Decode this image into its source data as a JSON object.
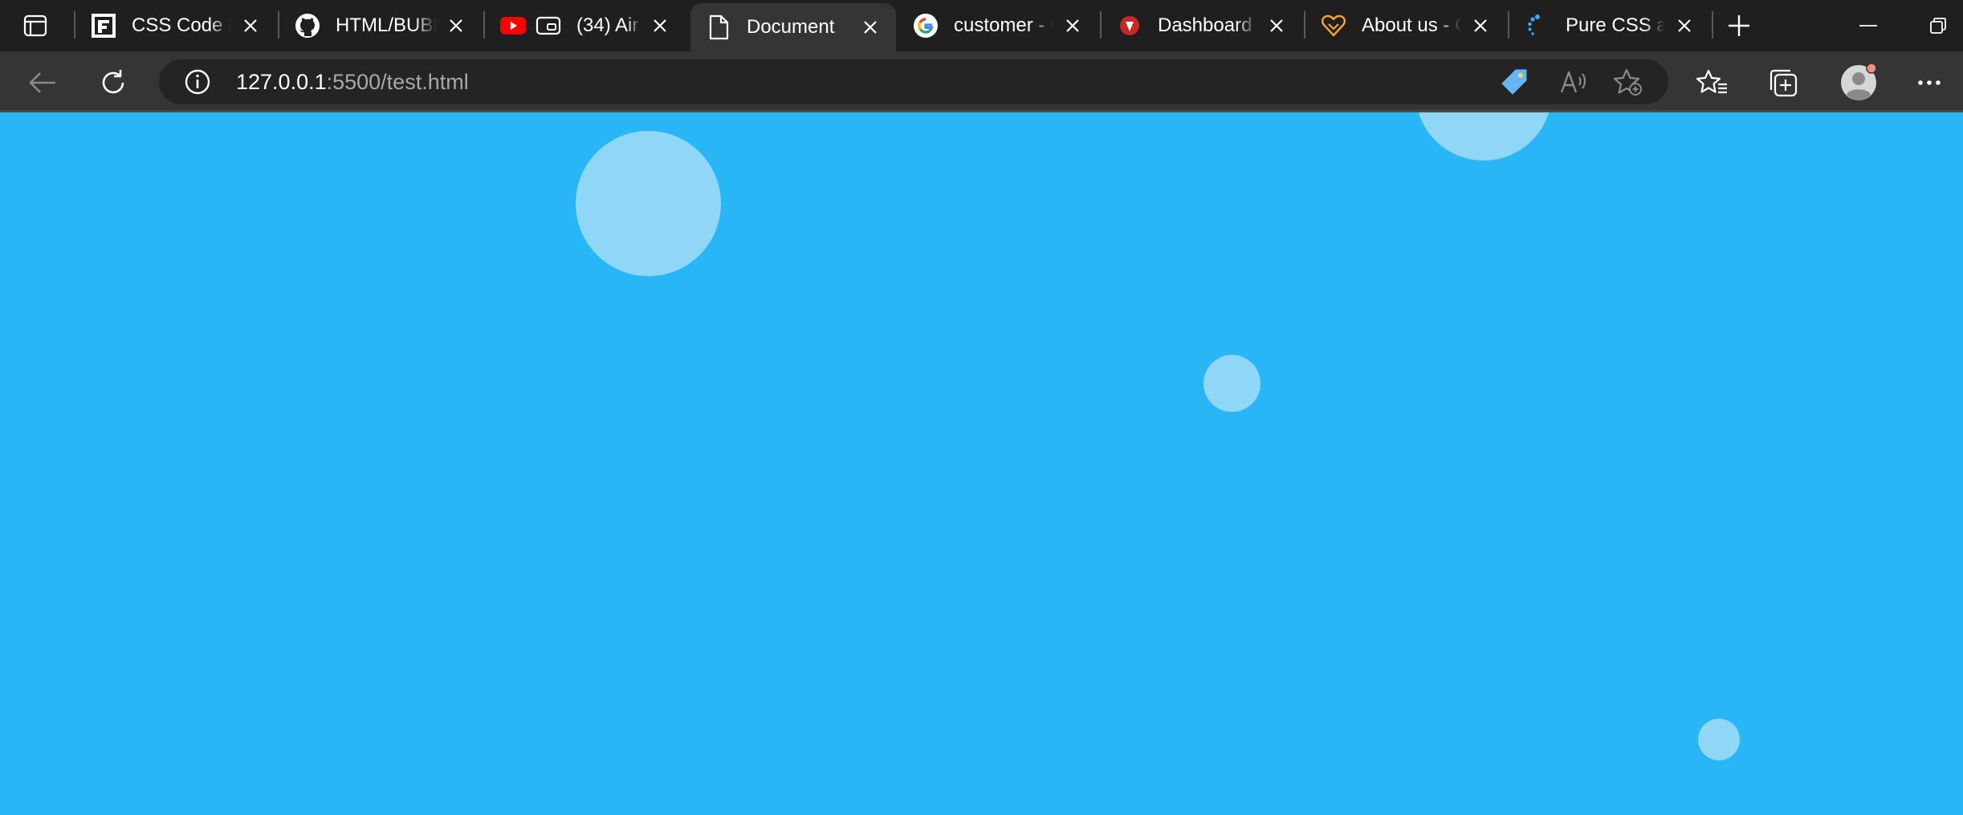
{
  "browser": {
    "tabs": [
      {
        "title": "CSS Code Examples",
        "icon": "f-logo-icon",
        "active": false
      },
      {
        "title": "HTML/BUBBLES",
        "icon": "github-icon",
        "active": false
      },
      {
        "title": "(34) Air",
        "icon": "youtube-icon",
        "active": false
      },
      {
        "title": "Document",
        "icon": "document-icon",
        "active": true
      },
      {
        "title": "customer - Google",
        "icon": "google-icon",
        "active": false
      },
      {
        "title": "Dashboard",
        "icon": "dashboard-favicon-icon",
        "active": false
      },
      {
        "title": "About us - C",
        "icon": "heart-icon",
        "active": false
      },
      {
        "title": "Pure CSS an",
        "icon": "loader-icon",
        "active": false
      }
    ],
    "url_host": "127.0.0.1",
    "url_rest": ":5500/test.html",
    "colors": {
      "page_background": "#29b6f6",
      "bubble": "#8fd6f7",
      "tab_strip": "#1f1f1f",
      "toolbar": "#353535"
    }
  }
}
